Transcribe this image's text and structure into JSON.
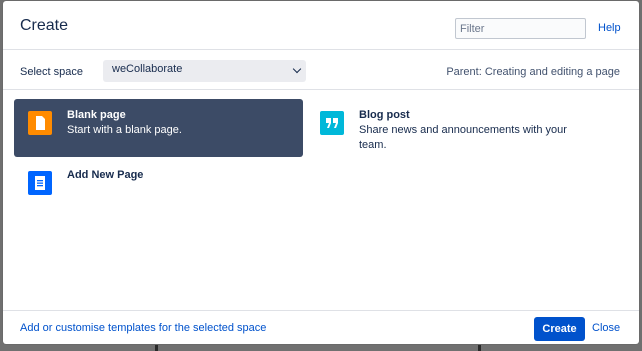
{
  "dialog": {
    "title": "Create",
    "filter_placeholder": "Filter",
    "help_label": "Help"
  },
  "space": {
    "label": "Select space",
    "selected": "weCollaborate",
    "parent_text": "Parent: Creating and editing a page"
  },
  "templates": [
    {
      "title": "Blank page",
      "description": "Start with a blank page.",
      "icon": "blank-page-icon",
      "color": "#ff8b00",
      "selected": true
    },
    {
      "title": "Blog post",
      "description": "Share news and announcements with your team.",
      "icon": "quote-icon",
      "color": "#00b8d9",
      "selected": false
    },
    {
      "title": "Add New Page",
      "description": "",
      "icon": "document-icon",
      "color": "#0065ff",
      "selected": false
    }
  ],
  "footer": {
    "customise_link": "Add or customise templates for the selected space",
    "create_label": "Create",
    "close_label": "Close"
  },
  "colors": {
    "accent": "#0052cc",
    "selected_tile": "#3c4b66"
  }
}
